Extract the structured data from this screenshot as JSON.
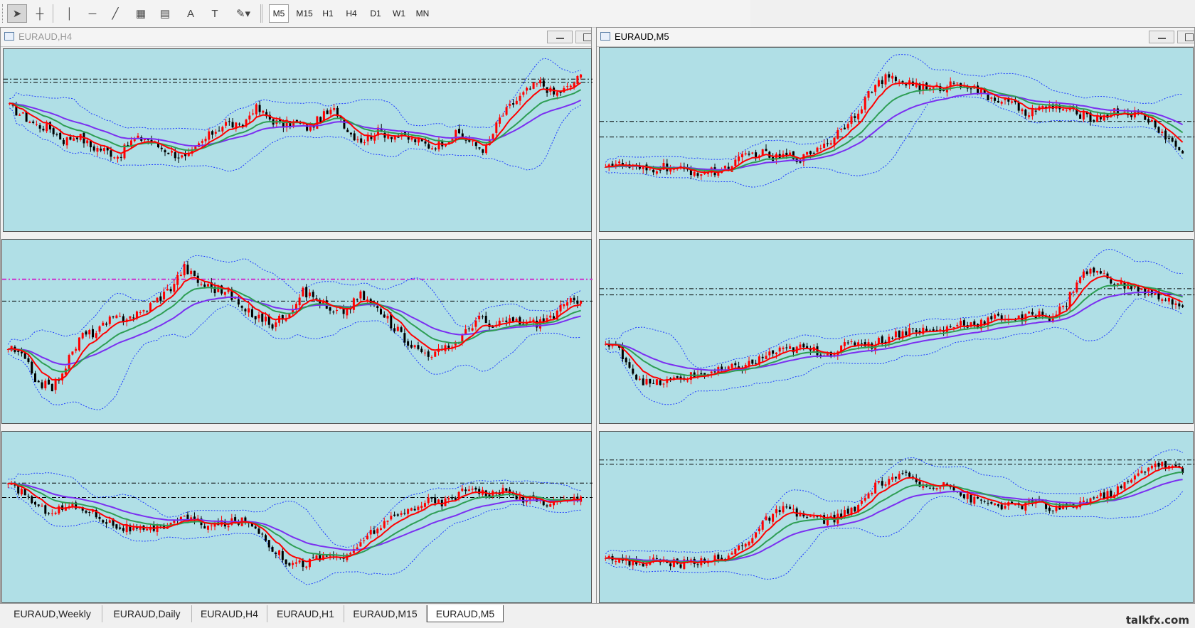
{
  "toolbar": {
    "tools": [
      {
        "name": "cursor-icon",
        "glyph": "➤",
        "active": true
      },
      {
        "name": "crosshair-icon",
        "glyph": "┼"
      },
      {
        "name": "vertical-line-icon",
        "glyph": "│"
      },
      {
        "name": "horizontal-line-icon",
        "glyph": "─"
      },
      {
        "name": "trendline-icon",
        "glyph": "╱"
      },
      {
        "name": "equidistant-channel-icon",
        "glyph": "▦"
      },
      {
        "name": "fibonacci-icon",
        "glyph": "▤"
      },
      {
        "name": "text-icon",
        "glyph": "A"
      },
      {
        "name": "text-label-icon",
        "glyph": "T"
      },
      {
        "name": "shapes-dropdown-icon",
        "glyph": "✎▾"
      }
    ],
    "timeframes": [
      "M5",
      "M15",
      "H1",
      "H4",
      "D1",
      "W1",
      "MN"
    ],
    "active_timeframe": "M5"
  },
  "windows": [
    {
      "title": "EURAUD,H4",
      "active": false
    },
    {
      "title": "EURAUD,M5",
      "active": true
    }
  ],
  "tabs": [
    "EURAUD,Weekly",
    "EURAUD,Daily",
    "EURAUD,H4",
    "EURAUD,H1",
    "EURAUD,M15",
    "EURAUD,M5"
  ],
  "active_tab": "EURAUD,M5",
  "brand": "talkfx.com",
  "colors": {
    "chart_bg": "#b0dfe6",
    "bull": "#ff0000",
    "bear": "#000000",
    "ma_fast": "#ff0000",
    "ma_mid": "#2e9e54",
    "ma_slow": "#7b2ff0",
    "bands": "#1f3cff",
    "level_magenta": "#cc33cc"
  },
  "chart_data": [
    {
      "type": "candlestick",
      "timeframe": "Weekly",
      "close_path": [
        0.72,
        0.66,
        0.6,
        0.58,
        0.5,
        0.54,
        0.46,
        0.44,
        0.4,
        0.5,
        0.52,
        0.46,
        0.42,
        0.38,
        0.48,
        0.56,
        0.62,
        0.58,
        0.72,
        0.65,
        0.6,
        0.62,
        0.58,
        0.66,
        0.7,
        0.55,
        0.5,
        0.56,
        0.54,
        0.52,
        0.5,
        0.46,
        0.5,
        0.55,
        0.48,
        0.44,
        0.64,
        0.74,
        0.82,
        0.88,
        0.8,
        0.84,
        0.92
      ],
      "levels": [
        0.9,
        0.88
      ]
    },
    {
      "type": "candlestick",
      "timeframe": "M15",
      "close_path": [
        0.35,
        0.34,
        0.32,
        0.3,
        0.33,
        0.31,
        0.3,
        0.29,
        0.3,
        0.34,
        0.4,
        0.42,
        0.38,
        0.4,
        0.38,
        0.45,
        0.5,
        0.6,
        0.7,
        0.84,
        0.9,
        0.88,
        0.86,
        0.82,
        0.84,
        0.88,
        0.84,
        0.78,
        0.76,
        0.72,
        0.68,
        0.7,
        0.72,
        0.68,
        0.66,
        0.64,
        0.68,
        0.68,
        0.66,
        0.6,
        0.5,
        0.42
      ],
      "levels": [
        0.62,
        0.52
      ]
    },
    {
      "type": "candlestick",
      "timeframe": "Daily",
      "close_path": [
        0.4,
        0.34,
        0.18,
        0.14,
        0.3,
        0.48,
        0.5,
        0.58,
        0.6,
        0.62,
        0.7,
        0.78,
        0.92,
        0.82,
        0.78,
        0.76,
        0.64,
        0.6,
        0.55,
        0.62,
        0.76,
        0.72,
        0.62,
        0.64,
        0.74,
        0.66,
        0.56,
        0.46,
        0.38,
        0.36,
        0.4,
        0.48,
        0.6,
        0.52,
        0.58,
        0.56,
        0.56,
        0.6,
        0.68,
        0.72
      ],
      "levels": [
        0.84,
        0.7
      ]
    },
    {
      "type": "candlestick",
      "timeframe": "M5",
      "close_path": [
        0.42,
        0.38,
        0.22,
        0.16,
        0.18,
        0.2,
        0.22,
        0.24,
        0.25,
        0.28,
        0.3,
        0.36,
        0.38,
        0.4,
        0.38,
        0.36,
        0.4,
        0.44,
        0.42,
        0.46,
        0.5,
        0.52,
        0.5,
        0.52,
        0.56,
        0.55,
        0.58,
        0.6,
        0.58,
        0.62,
        0.6,
        0.66,
        0.86,
        0.9,
        0.84,
        0.8,
        0.78,
        0.74,
        0.72,
        0.64
      ],
      "levels": [
        0.78,
        0.74
      ]
    },
    {
      "type": "candlestick",
      "timeframe": "H1",
      "close_path": [
        0.72,
        0.68,
        0.56,
        0.55,
        0.58,
        0.56,
        0.5,
        0.44,
        0.42,
        0.4,
        0.44,
        0.5,
        0.48,
        0.44,
        0.46,
        0.48,
        0.44,
        0.3,
        0.2,
        0.18,
        0.22,
        0.24,
        0.22,
        0.36,
        0.44,
        0.5,
        0.56,
        0.62,
        0.6,
        0.66,
        0.72,
        0.66,
        0.68,
        0.64,
        0.62,
        0.6,
        0.62,
        0.64
      ],
      "levels": [
        0.74,
        0.64
      ]
    },
    {
      "type": "candlestick",
      "timeframe": "M5",
      "close_path": [
        0.25,
        0.2,
        0.18,
        0.2,
        0.2,
        0.18,
        0.2,
        0.22,
        0.2,
        0.3,
        0.38,
        0.5,
        0.56,
        0.52,
        0.5,
        0.48,
        0.52,
        0.56,
        0.7,
        0.76,
        0.8,
        0.74,
        0.7,
        0.76,
        0.66,
        0.62,
        0.6,
        0.58,
        0.58,
        0.62,
        0.56,
        0.56,
        0.6,
        0.64,
        0.66,
        0.72,
        0.8,
        0.88,
        0.86,
        0.82
      ],
      "levels": [
        0.9,
        0.87
      ]
    }
  ]
}
